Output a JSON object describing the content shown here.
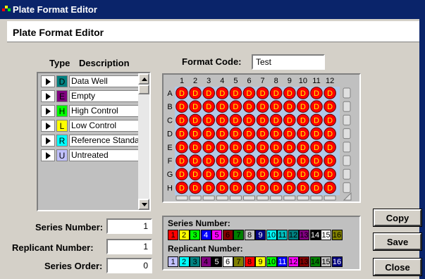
{
  "window": {
    "title": "Plate Format Editor",
    "header": "Plate Format Editor"
  },
  "type_list": {
    "type_header": "Type",
    "desc_header": "Description",
    "items": [
      {
        "code": "D",
        "color": "#008080",
        "label": "Data Well"
      },
      {
        "code": "E",
        "color": "#800080",
        "label": "Empty"
      },
      {
        "code": "H",
        "color": "#00ff00",
        "label": "High Control"
      },
      {
        "code": "L",
        "color": "#ffff00",
        "label": "Low Control"
      },
      {
        "code": "R",
        "color": "#00ffff",
        "label": "Reference Standar"
      },
      {
        "code": "U",
        "color": "#c0c0ff",
        "label": "Untreated"
      }
    ]
  },
  "format_code": {
    "label": "Format Code:",
    "value": "Test"
  },
  "plate": {
    "columns": [
      "1",
      "2",
      "3",
      "4",
      "5",
      "6",
      "7",
      "8",
      "9",
      "10",
      "11",
      "12"
    ],
    "rows": [
      "A",
      "B",
      "C",
      "D",
      "E",
      "F",
      "G",
      "H"
    ],
    "well_code": "D",
    "well_color": "#ff0000",
    "background": "#b0c8e8"
  },
  "fields": {
    "series_number": {
      "label": "Series Number:",
      "value": "1"
    },
    "replicant_number": {
      "label": "Replicant Number:",
      "value": "1"
    },
    "series_order": {
      "label": "Series Order:",
      "value": "0"
    }
  },
  "legend": {
    "series_label": "Series Number:",
    "replicant_label": "Replicant Number:",
    "series": [
      {
        "n": "1",
        "bg": "#ff0000",
        "fg": "#000000"
      },
      {
        "n": "2",
        "bg": "#ffff00",
        "fg": "#000000"
      },
      {
        "n": "3",
        "bg": "#00ff00",
        "fg": "#000000"
      },
      {
        "n": "4",
        "bg": "#0000ff",
        "fg": "#ffffff"
      },
      {
        "n": "5",
        "bg": "#ff00ff",
        "fg": "#000000"
      },
      {
        "n": "6",
        "bg": "#800000",
        "fg": "#000000"
      },
      {
        "n": "7",
        "bg": "#008000",
        "fg": "#000000"
      },
      {
        "n": "8",
        "bg": "#c0c0c0",
        "fg": "#000000"
      },
      {
        "n": "9",
        "bg": "#000080",
        "fg": "#ffffff"
      },
      {
        "n": "10",
        "bg": "#00ffff",
        "fg": "#000000"
      },
      {
        "n": "11",
        "bg": "#00c0c0",
        "fg": "#000000"
      },
      {
        "n": "12",
        "bg": "#008080",
        "fg": "#000000"
      },
      {
        "n": "13",
        "bg": "#800080",
        "fg": "#000000"
      },
      {
        "n": "14",
        "bg": "#000000",
        "fg": "#ffffff"
      },
      {
        "n": "15",
        "bg": "#ffffff",
        "fg": "#000000"
      },
      {
        "n": "16",
        "bg": "#808000",
        "fg": "#000000"
      }
    ],
    "replicant": [
      {
        "n": "1",
        "bg": "#c0c0ff",
        "fg": "#000000"
      },
      {
        "n": "2",
        "bg": "#00ffff",
        "fg": "#000000"
      },
      {
        "n": "3",
        "bg": "#008080",
        "fg": "#000000"
      },
      {
        "n": "4",
        "bg": "#800080",
        "fg": "#000000"
      },
      {
        "n": "5",
        "bg": "#000000",
        "fg": "#ffffff"
      },
      {
        "n": "6",
        "bg": "#ffffff",
        "fg": "#000000"
      },
      {
        "n": "7",
        "bg": "#808000",
        "fg": "#000000"
      },
      {
        "n": "8",
        "bg": "#ff0000",
        "fg": "#000000"
      },
      {
        "n": "9",
        "bg": "#ffff00",
        "fg": "#000000"
      },
      {
        "n": "10",
        "bg": "#00ff00",
        "fg": "#000000"
      },
      {
        "n": "11",
        "bg": "#0000ff",
        "fg": "#ffffff"
      },
      {
        "n": "12",
        "bg": "#ff00ff",
        "fg": "#000000"
      },
      {
        "n": "13",
        "bg": "#800000",
        "fg": "#000000"
      },
      {
        "n": "14",
        "bg": "#008000",
        "fg": "#000000"
      },
      {
        "n": "15",
        "bg": "#c0c0c0",
        "fg": "#000000"
      },
      {
        "n": "16",
        "bg": "#000080",
        "fg": "#ffffff"
      }
    ]
  },
  "buttons": {
    "copy": "Copy",
    "save": "Save",
    "close": "Close"
  }
}
